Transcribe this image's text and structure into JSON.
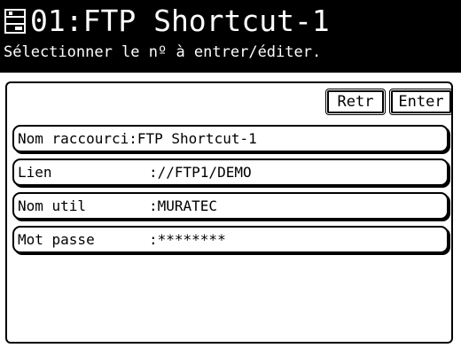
{
  "header": {
    "icon": "address-book-icon",
    "title": "01:FTP Shortcut-1",
    "subtitle": "Sélectionner le nº à entrer/éditer."
  },
  "toolbar": {
    "retr_label": "Retr",
    "enter_label": "Enter"
  },
  "rows": [
    {
      "label": "Nom raccourci",
      "value": ":FTP Shortcut-1"
    },
    {
      "label": "Lien",
      "value": "://FTP1/DEMO"
    },
    {
      "label": "Nom util",
      "value": ":MURATEC"
    },
    {
      "label": "Mot passe",
      "value": ":********"
    }
  ],
  "colors": {
    "header_bg": "#000000",
    "header_fg": "#ffffff",
    "panel_bg": "#ffffff",
    "border": "#000000"
  }
}
